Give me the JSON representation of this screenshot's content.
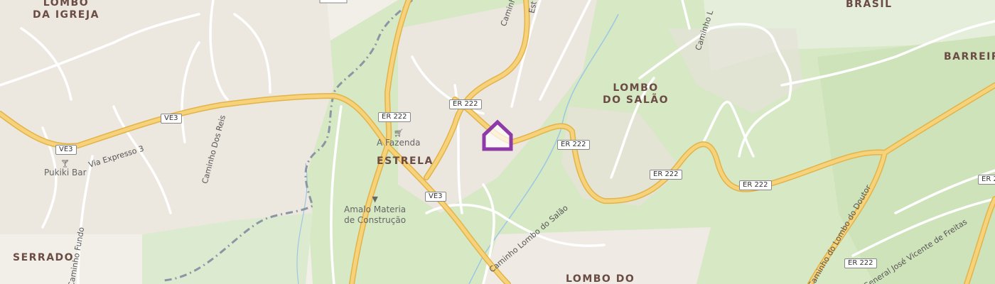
{
  "map": {
    "places": {
      "lombo_da_igreja": [
        "LOMBO",
        "DA IGREJA"
      ],
      "brasil": "BRASIL",
      "barreiro": "BARREIRO",
      "lombo_do_salao": [
        "LOMBO",
        "DO SALÃO"
      ],
      "estrela": "ESTRELA",
      "serrado": "SERRADO",
      "lombo_do": "LOMBO DO"
    },
    "pois": {
      "pukiki_bar": "Pukiki Bar",
      "a_fazenda": "A Fazenda",
      "amalo": [
        "Amalo Materia",
        "de Construção"
      ]
    },
    "streets": {
      "via_expresso_3": "Via Expresso 3",
      "caminho_dos_reis": "Caminho Dos Reis",
      "caminho_fundo": "Caminho Fundo",
      "caminho_lombo_do_salao": "Caminho Lombo do Salão",
      "caminho_lombo_do_doutor": "Caminho do Lombo do Doutor",
      "general_jose": "General José Vicente de Freitas",
      "caminho_top1": "Caminho",
      "caminho_top2": "Caminho L",
      "est_top": "Est"
    },
    "shields": {
      "ve3": "VE3",
      "er222": "ER 222"
    },
    "icons": {
      "marker": "home-marker-icon",
      "bar": "cocktail-icon",
      "shop": "shopping-cart-icon",
      "hardware": "basket-icon"
    },
    "colors": {
      "land": "#f2efe9",
      "forest": "#d6e8c4",
      "major_road": "#f6d37a",
      "road_casing": "#e3b349",
      "minor_road": "#ffffff",
      "water": "#9cc7e4",
      "marker": "#8e3aa8",
      "boundary": "#8a96a3"
    }
  }
}
